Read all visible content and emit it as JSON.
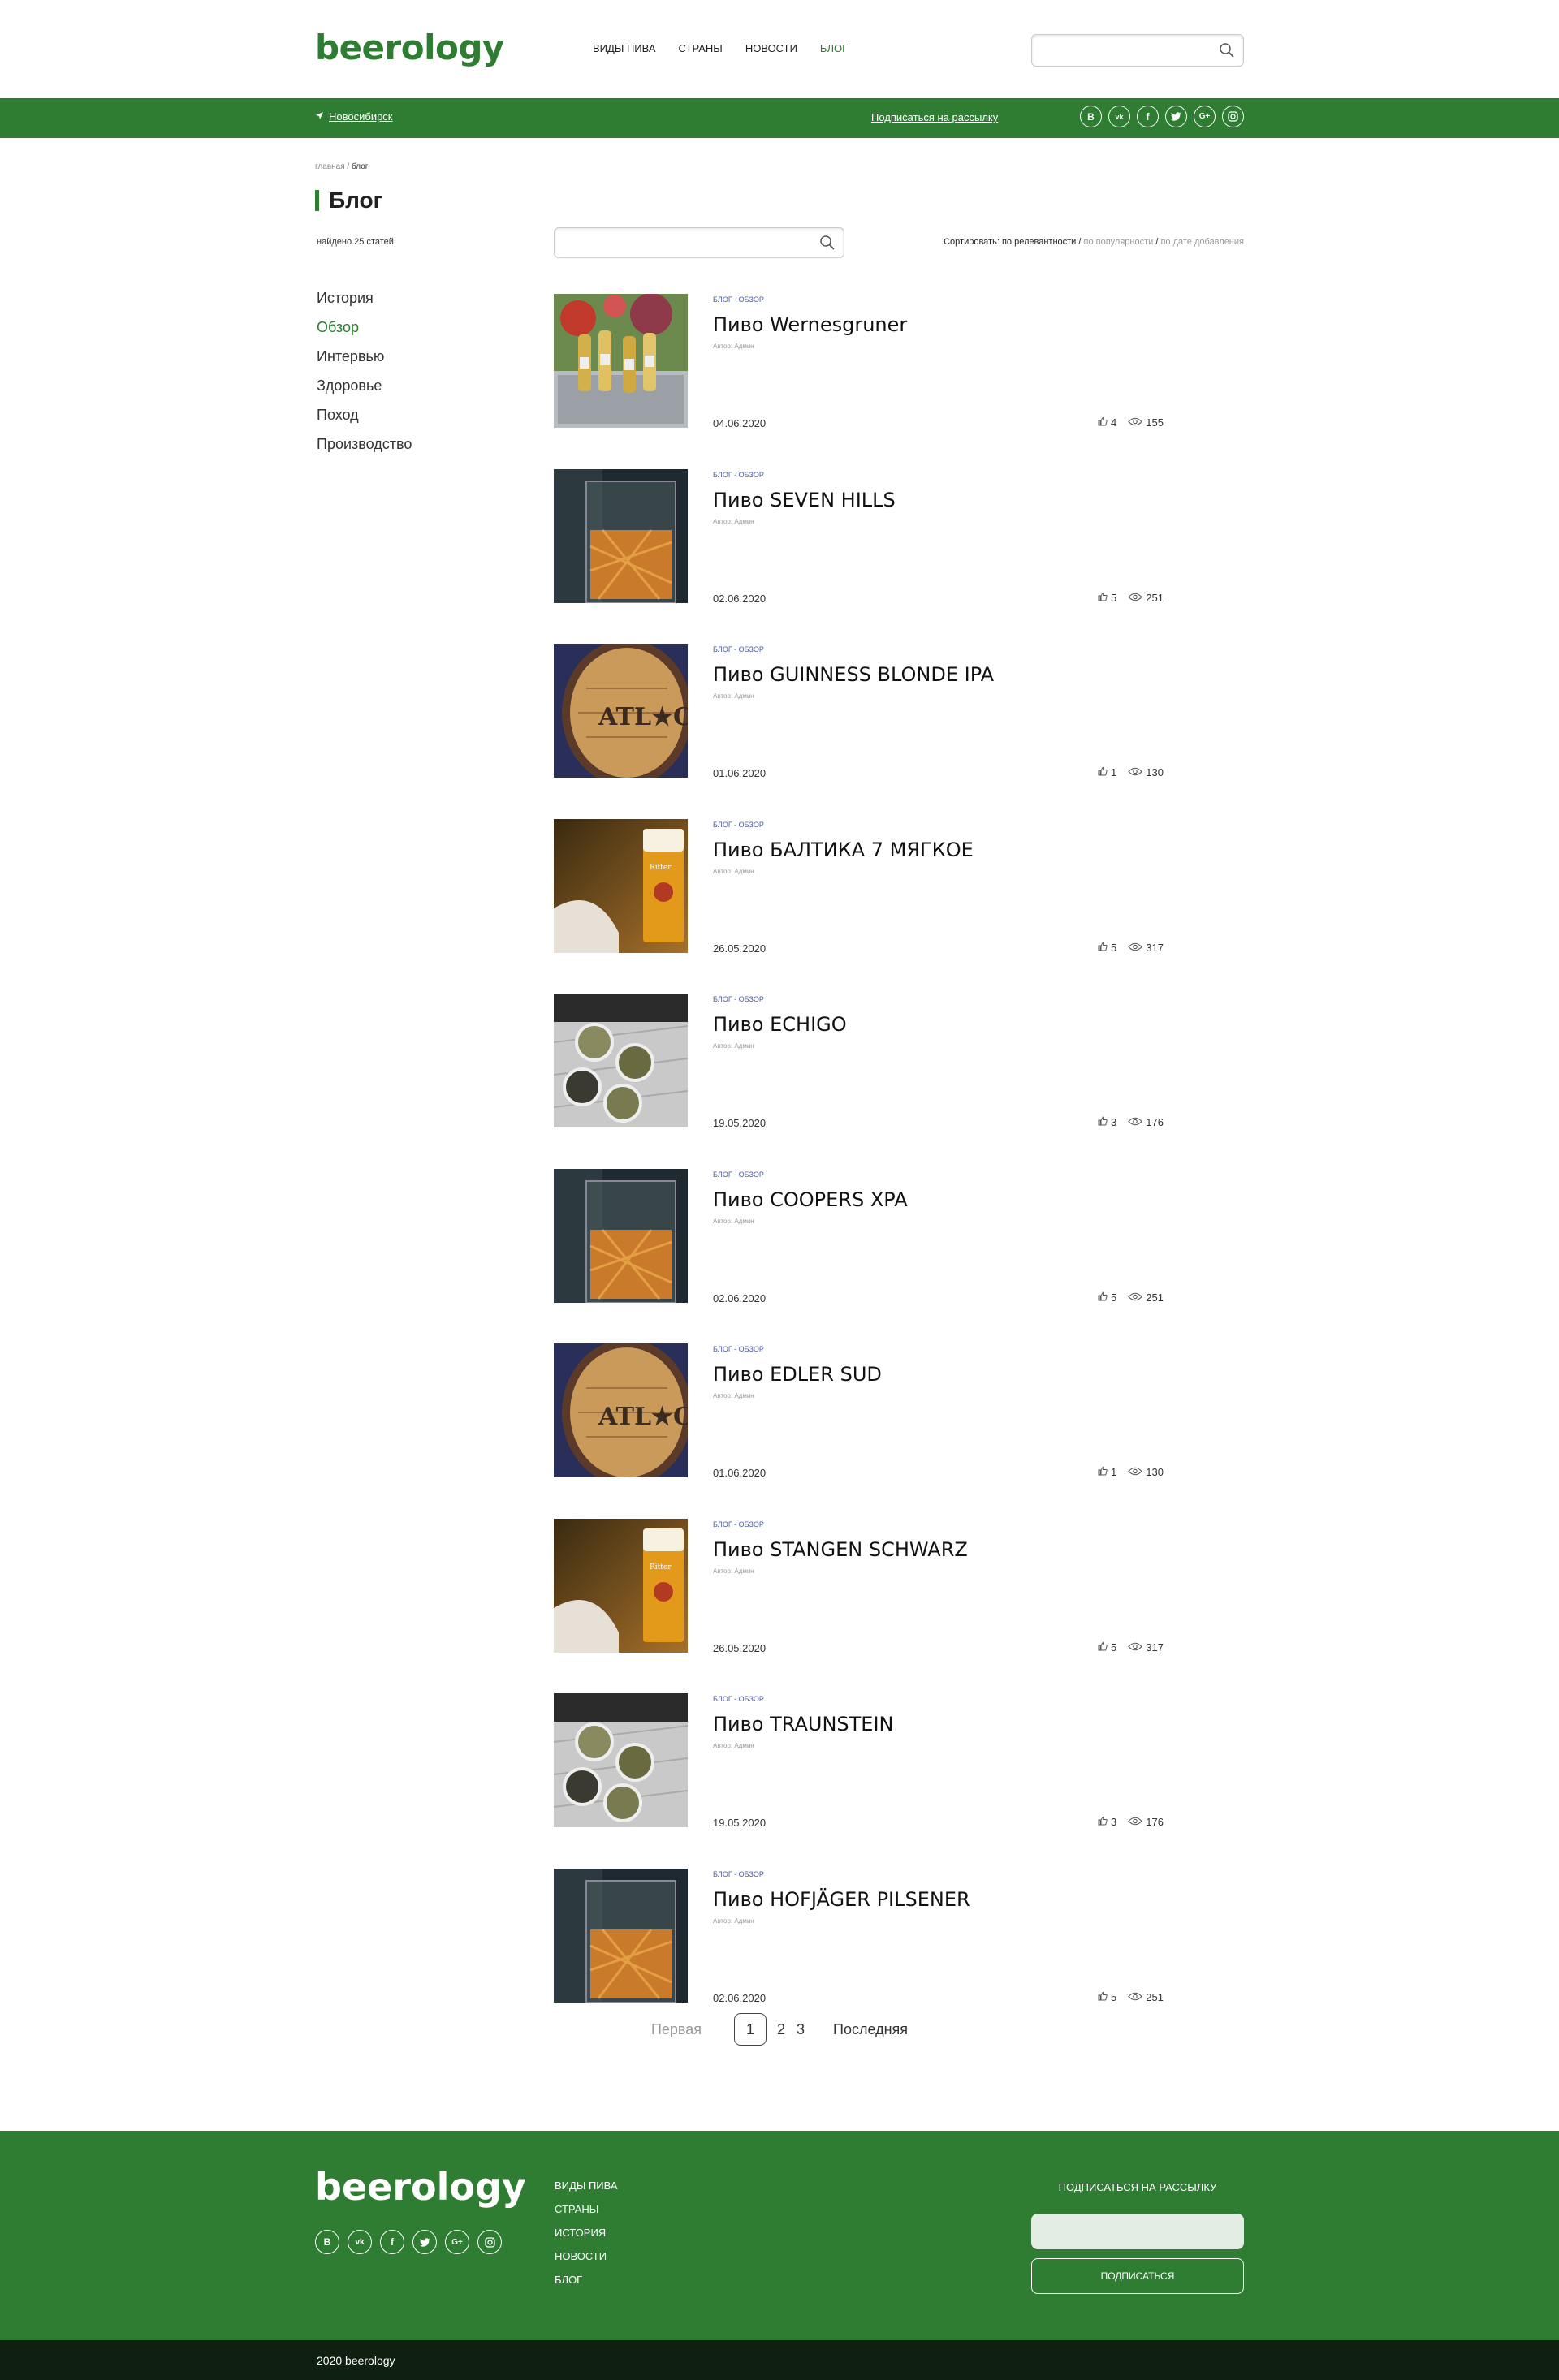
{
  "header": {
    "logo": "beerology",
    "nav": [
      "ВИДЫ ПИВА",
      "СТРАНЫ",
      "НОВОСТИ",
      "БЛОГ"
    ],
    "active_nav": "БЛОГ",
    "search": {
      "placeholder": "",
      "value": ""
    }
  },
  "topbar": {
    "city": "Новосибирск",
    "subscribe": "Подписаться на рассылку",
    "socials": [
      "vkontakte-b-icon",
      "vk-icon",
      "facebook-icon",
      "twitter-icon",
      "google-plus-icon",
      "instagram-icon"
    ]
  },
  "breadcrumb": {
    "home": "главная",
    "sep": " / ",
    "current": "блог"
  },
  "page_title": "Блог",
  "found": "найдено 25 статей",
  "blog_search": {
    "placeholder": "",
    "value": ""
  },
  "sort": {
    "label": "Сортировать:",
    "options": [
      "по релевантности",
      "по популярности",
      "по дате добавления"
    ],
    "active": "по релевантности"
  },
  "categories": [
    "История",
    "Обзор",
    "Интервью",
    "Здоровье",
    "Поход",
    "Производство"
  ],
  "active_category": "Обзор",
  "posts": [
    {
      "cat": "БЛОГ - ОБЗОР",
      "title": "Пиво Wernesgruner",
      "author": "Автор: Админ",
      "date": "04.06.2020",
      "likes": "4",
      "views": "155",
      "image": "bottles-in-ice-bucket"
    },
    {
      "cat": "БЛОГ - ОБЗОР",
      "title": "Пиво SEVEN HILLS",
      "author": "Автор: Админ",
      "date": "02.06.2020",
      "likes": "5",
      "views": "251",
      "image": "glass-of-drink"
    },
    {
      "cat": "БЛОГ - ОБЗОР",
      "title": "Пиво GUINNESS BLONDE IPA",
      "author": "Автор: Админ",
      "date": "01.06.2020",
      "likes": "1",
      "views": "130",
      "image": "wooden-barrel"
    },
    {
      "cat": "БЛОГ - ОБЗОР",
      "title": "Пиво БАЛТИКА 7 МЯГКОЕ",
      "author": "Автор: Админ",
      "date": "26.05.2020",
      "likes": "5",
      "views": "317",
      "image": "beer-glass"
    },
    {
      "cat": "БЛОГ - ОБЗОР",
      "title": "Пиво ECHIGO",
      "author": "Автор: Админ",
      "date": "19.05.2020",
      "likes": "3",
      "views": "176",
      "image": "hop-pellets"
    },
    {
      "cat": "БЛОГ - ОБЗОР",
      "title": "Пиво COOPERS XPA",
      "author": "Автор: Админ",
      "date": "02.06.2020",
      "likes": "5",
      "views": "251",
      "image": "glass-of-drink"
    },
    {
      "cat": "БЛОГ - ОБЗОР",
      "title": "Пиво EDLER SUD",
      "author": "Автор: Админ",
      "date": "01.06.2020",
      "likes": "1",
      "views": "130",
      "image": "wooden-barrel"
    },
    {
      "cat": "БЛОГ - ОБЗОР",
      "title": "Пиво STANGEN SCHWARZ",
      "author": "Автор: Админ",
      "date": "26.05.2020",
      "likes": "5",
      "views": "317",
      "image": "beer-glass"
    },
    {
      "cat": "БЛОГ - ОБЗОР",
      "title": "Пиво TRAUNSTEIN",
      "author": "Автор: Админ",
      "date": "19.05.2020",
      "likes": "3",
      "views": "176",
      "image": "hop-pellets"
    },
    {
      "cat": "БЛОГ - ОБЗОР",
      "title": "Пиво HOFJÄGER PILSENER",
      "author": "Автор: Админ",
      "date": "02.06.2020",
      "likes": "5",
      "views": "251",
      "image": "glass-of-drink"
    }
  ],
  "pager": {
    "first": "Первая",
    "pages": [
      "1",
      "2",
      "3"
    ],
    "current": "1",
    "last": "Последняя"
  },
  "footer": {
    "logo": "beerology",
    "links": [
      "ВИДЫ ПИВА",
      "СТРАНЫ",
      "ИСТОРИЯ",
      "НОВОСТИ",
      "БЛОГ"
    ],
    "subscribe_title": "ПОДПИСАТЬСЯ НА РАССЫЛКУ",
    "email_placeholder": "",
    "subscribe_button": "ПОДПИСАТЬСЯ",
    "copyright": "2020 beerology"
  },
  "colors": {
    "brand_green": "#2e7d32",
    "dark_bar": "#0f1f10",
    "category_link": "#4a5aa8"
  }
}
